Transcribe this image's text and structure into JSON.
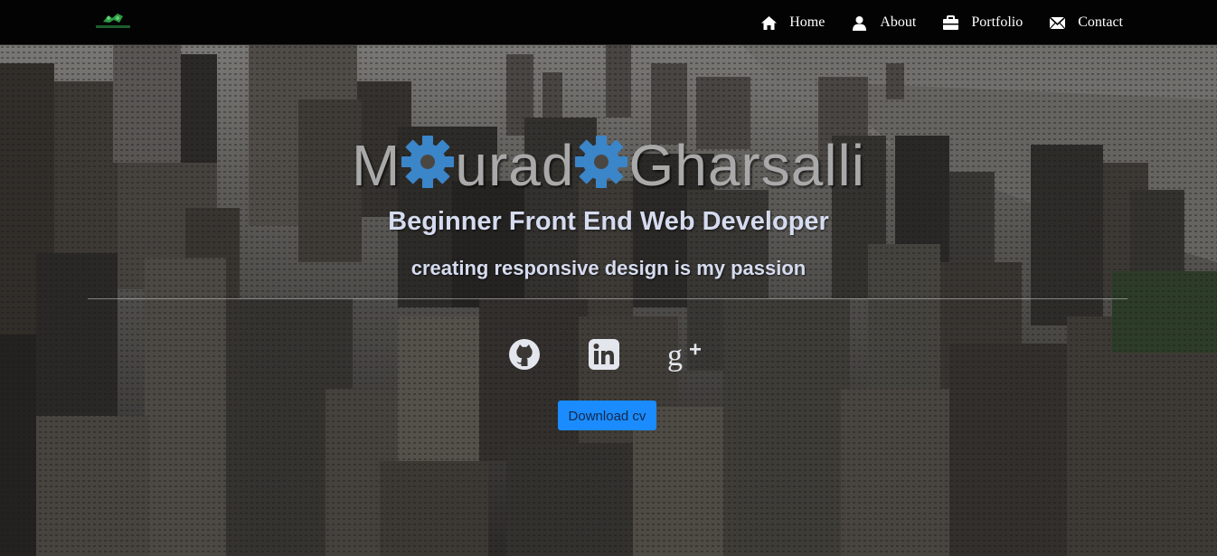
{
  "nav": {
    "items": [
      {
        "label": "Home",
        "icon": "home-icon"
      },
      {
        "label": "About",
        "icon": "user-icon"
      },
      {
        "label": "Portfolio",
        "icon": "briefcase-icon"
      },
      {
        "label": "Contact",
        "icon": "envelope-icon"
      }
    ]
  },
  "hero": {
    "name_parts": [
      "M",
      "urad",
      "Gharsalli"
    ],
    "subtitle": "Beginner Front End Web Developer",
    "tagline": "creating responsive design is my passion",
    "socials": [
      "github-icon",
      "linkedin-icon",
      "google-plus-icon"
    ],
    "download_label": "Download cv"
  },
  "colors": {
    "navbar_bg": "#030303",
    "gear_blue": "#3b85c9",
    "button_blue": "#1a8cff",
    "name_gray": "#a9a9a9",
    "subtitle_color": "#d6dcf0"
  }
}
